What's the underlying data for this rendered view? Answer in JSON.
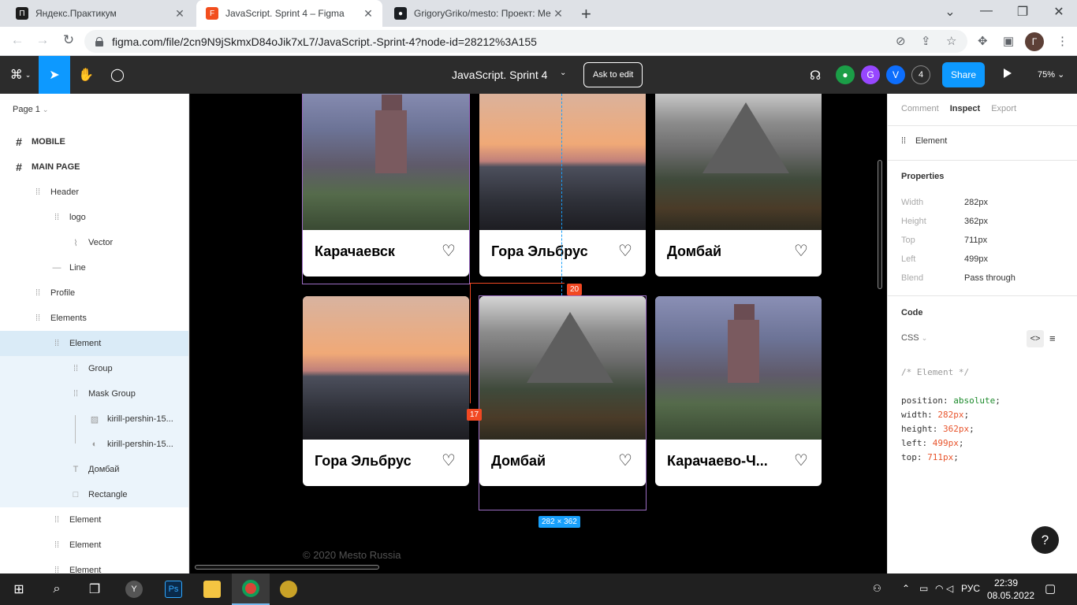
{
  "browser": {
    "tabs": [
      {
        "label": "Яндекс.Практикум",
        "favicon": "П",
        "color": "#1d1d1d"
      },
      {
        "label": "JavaScript. Sprint 4 – Figma",
        "favicon": "F",
        "color": "#f24e1e",
        "active": true
      },
      {
        "label": "GrigoryGriko/mesto: Проект: Ме",
        "favicon": "●",
        "color": "#1b1f23"
      }
    ],
    "new_tab": "+",
    "url": "figma.com/file/2cn9N9jSkmxD84oJik7xL7/JavaScript.-Sprint-4?node-id=28212%3A155",
    "profile_initial": "Г"
  },
  "figma": {
    "file_title": "JavaScript. Sprint 4",
    "ask_to_edit": "Ask to edit",
    "share": "Share",
    "collaborator_count": "4",
    "zoom": "75%",
    "avatars": [
      {
        "initial": "",
        "color": "#1b9e47"
      },
      {
        "initial": "G",
        "color": "#9747ff"
      },
      {
        "initial": "V",
        "color": "#0d6efd"
      }
    ]
  },
  "layers": {
    "page": "Page 1",
    "items": [
      {
        "name": "MOBILE",
        "icon": "frame",
        "bold": true,
        "indent": 0
      },
      {
        "name": "MAIN PAGE",
        "icon": "frame",
        "bold": true,
        "indent": 0
      },
      {
        "name": "Header",
        "icon": "group",
        "indent": 1
      },
      {
        "name": "logo",
        "icon": "group",
        "indent": 2
      },
      {
        "name": "Vector",
        "icon": "vector",
        "indent": 3
      },
      {
        "name": "Line",
        "icon": "line",
        "indent": 2
      },
      {
        "name": "Profile",
        "icon": "group",
        "indent": 1
      },
      {
        "name": "Elements",
        "icon": "group",
        "indent": 1
      },
      {
        "name": "Element",
        "icon": "group",
        "indent": 2,
        "selected": true
      },
      {
        "name": "Group",
        "icon": "group",
        "indent": 3,
        "child": true
      },
      {
        "name": "Mask Group",
        "icon": "group",
        "indent": 3,
        "child": true
      },
      {
        "name": "kirill-pershin-15...",
        "icon": "image",
        "indent": 4,
        "child": true
      },
      {
        "name": "kirill-pershin-15...",
        "icon": "mask",
        "indent": 4,
        "child": true
      },
      {
        "name": "Домбай",
        "icon": "text",
        "indent": 3,
        "child": true
      },
      {
        "name": "Rectangle",
        "icon": "rect",
        "indent": 3,
        "child": true
      },
      {
        "name": "Element",
        "icon": "group",
        "indent": 2
      },
      {
        "name": "Element",
        "icon": "group",
        "indent": 2
      },
      {
        "name": "Element",
        "icon": "group",
        "indent": 2
      }
    ]
  },
  "canvas": {
    "cards": [
      {
        "title": "Карачаевск",
        "photo": "church"
      },
      {
        "title": "Гора Эльбрус",
        "photo": "sunset"
      },
      {
        "title": "Домбай",
        "photo": "mountain"
      },
      {
        "title": "Гора Эльбрус",
        "photo": "sunset"
      },
      {
        "title": "Домбай",
        "photo": "mountain"
      },
      {
        "title": "Карачаево-Ч...",
        "photo": "church"
      }
    ],
    "heart_icon": "♡",
    "gap_horizontal": "20",
    "gap_vertical": "17",
    "size_badge": "282 × 362",
    "footer": "© 2020 Mesto Russia"
  },
  "inspect": {
    "tabs": [
      "Comment",
      "Inspect",
      "Export"
    ],
    "active_tab": "Inspect",
    "element_label": "Element",
    "properties_title": "Properties",
    "properties": [
      {
        "key": "Width",
        "value": "282px"
      },
      {
        "key": "Height",
        "value": "362px"
      },
      {
        "key": "Top",
        "value": "711px"
      },
      {
        "key": "Left",
        "value": "499px"
      },
      {
        "key": "Blend",
        "value": "Pass through"
      }
    ],
    "code_title": "Code",
    "code_lang": "CSS",
    "code_comment": "/* Element */",
    "code_lines": [
      {
        "prop": "position",
        "value": "absolute",
        "kind": "keyword"
      },
      {
        "prop": "width",
        "value": "282px",
        "kind": "number"
      },
      {
        "prop": "height",
        "value": "362px",
        "kind": "number"
      },
      {
        "prop": "left",
        "value": "499px",
        "kind": "number"
      },
      {
        "prop": "top",
        "value": "711px",
        "kind": "number"
      }
    ],
    "help": "?"
  },
  "taskbar": {
    "lang": "РУС",
    "time": "22:39",
    "date": "08.05.2022"
  }
}
